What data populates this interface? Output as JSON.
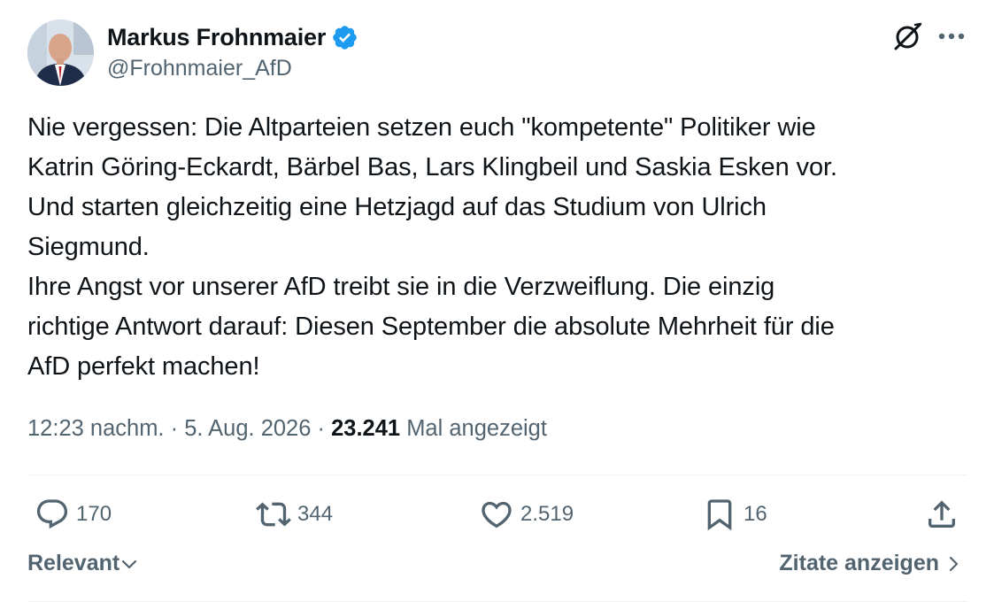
{
  "author": {
    "display_name": "Markus Frohnmaier",
    "handle": "@Frohnmaier_AfD",
    "verified": true
  },
  "tweet": {
    "text": "Nie vergessen: Die Altparteien setzen euch \"kompetente\" Politiker wie\nKatrin Göring-Eckardt, Bärbel Bas, Lars Klingbeil und Saskia Esken vor.\nUnd starten gleichzeitig eine Hetzjagd auf das Studium von Ulrich\nSiegmund.\nIhre Angst vor unserer AfD treibt sie in die Verzweiflung. Die einzig\nrichtige Antwort darauf: Diesen September die absolute Mehrheit für die\nAfD perfekt machen!"
  },
  "meta": {
    "time": "12:23 nachm.",
    "sep1": " · ",
    "date": "5. Aug. 2026",
    "sep2": " · ",
    "views_count": "23.241",
    "views_label": "Mal angezeigt"
  },
  "actions": {
    "replies": "170",
    "reposts": "344",
    "likes": "2.519",
    "bookmarks": "16"
  },
  "footer": {
    "sort_label": "Relevant",
    "quotes_label": "Zitate anzeigen"
  },
  "colors": {
    "verified_blue": "#1d9bf0",
    "text_primary": "#0f1419",
    "text_secondary": "#536471",
    "divider": "#eff3f4"
  },
  "icons": {
    "grok": "grok-icon",
    "more": "more-dots-icon",
    "reply": "reply-bubble-icon",
    "repost": "repost-arrows-icon",
    "like": "heart-icon",
    "bookmark": "bookmark-icon",
    "share": "share-upload-icon"
  }
}
